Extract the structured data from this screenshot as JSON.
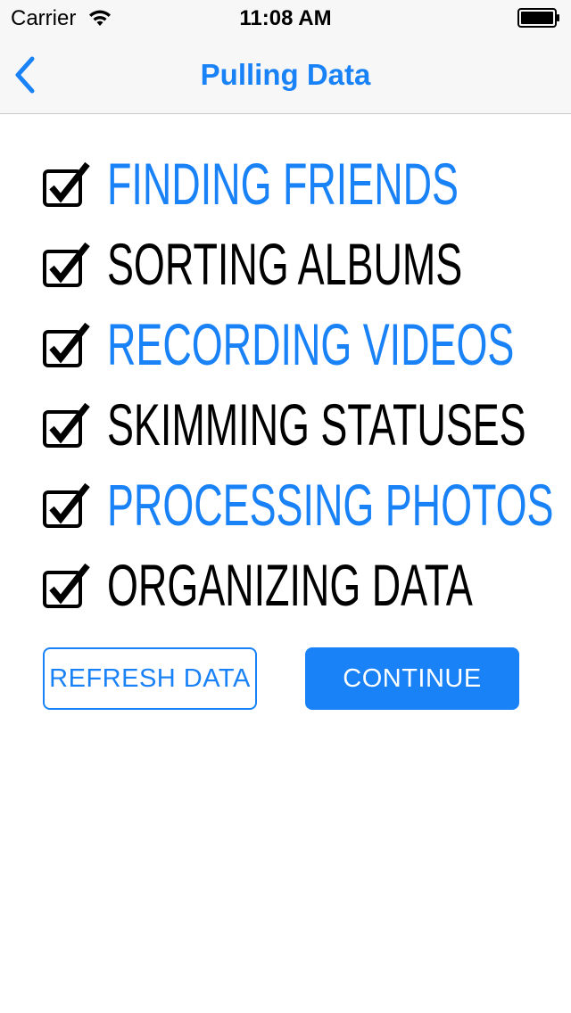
{
  "status_bar": {
    "carrier": "Carrier",
    "time": "11:08 AM"
  },
  "nav": {
    "title": "Pulling Data",
    "back_icon": "chevron-left-icon"
  },
  "checklist": [
    {
      "label": "FINDING FRIENDS",
      "checked": true,
      "color": "#1a82f7"
    },
    {
      "label": "SORTING ALBUMS",
      "checked": true,
      "color": "#000000"
    },
    {
      "label": "RECORDING VIDEOS",
      "checked": true,
      "color": "#1a82f7"
    },
    {
      "label": "SKIMMING STATUSES",
      "checked": true,
      "color": "#000000"
    },
    {
      "label": "PROCESSING PHOTOS",
      "checked": true,
      "color": "#1a82f7"
    },
    {
      "label": "ORGANIZING DATA",
      "checked": true,
      "color": "#000000"
    }
  ],
  "buttons": {
    "refresh_label": "REFRESH DATA",
    "continue_label": "CONTINUE"
  },
  "colors": {
    "accent": "#1a82f7",
    "bar_background": "#f7f7f7"
  }
}
